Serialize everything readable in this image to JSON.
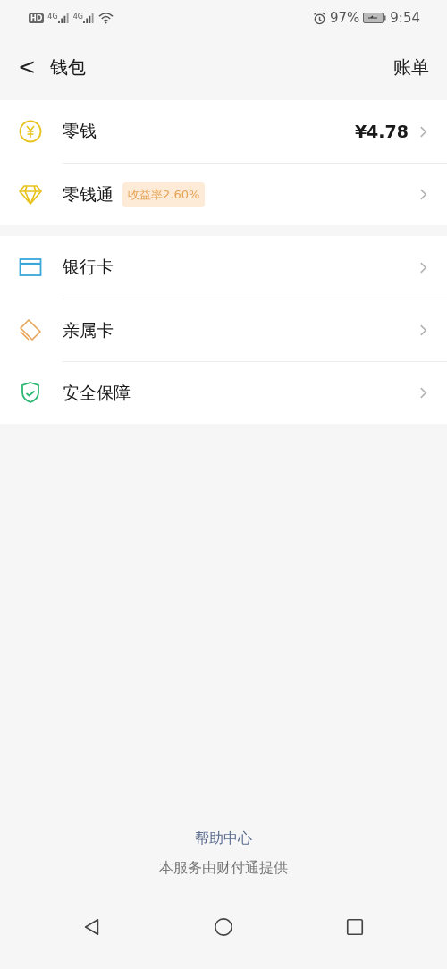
{
  "status_bar": {
    "hd": "HD",
    "networks": [
      "4G",
      "4G"
    ],
    "battery": "97%",
    "time": "9:54"
  },
  "header": {
    "back": "<",
    "title": "钱包",
    "action": "账单"
  },
  "groups": [
    {
      "items": [
        {
          "kind": "coin",
          "label": "零钱",
          "value": "¥4.78"
        },
        {
          "kind": "diamond",
          "label": "零钱通",
          "badge": "收益率2.60%"
        }
      ]
    },
    {
      "items": [
        {
          "kind": "card",
          "label": "银行卡"
        },
        {
          "kind": "family-card",
          "label": "亲属卡"
        },
        {
          "kind": "shield",
          "label": "安全保障"
        }
      ]
    }
  ],
  "footer": {
    "link": "帮助中心",
    "note": "本服务由财付通提供"
  }
}
